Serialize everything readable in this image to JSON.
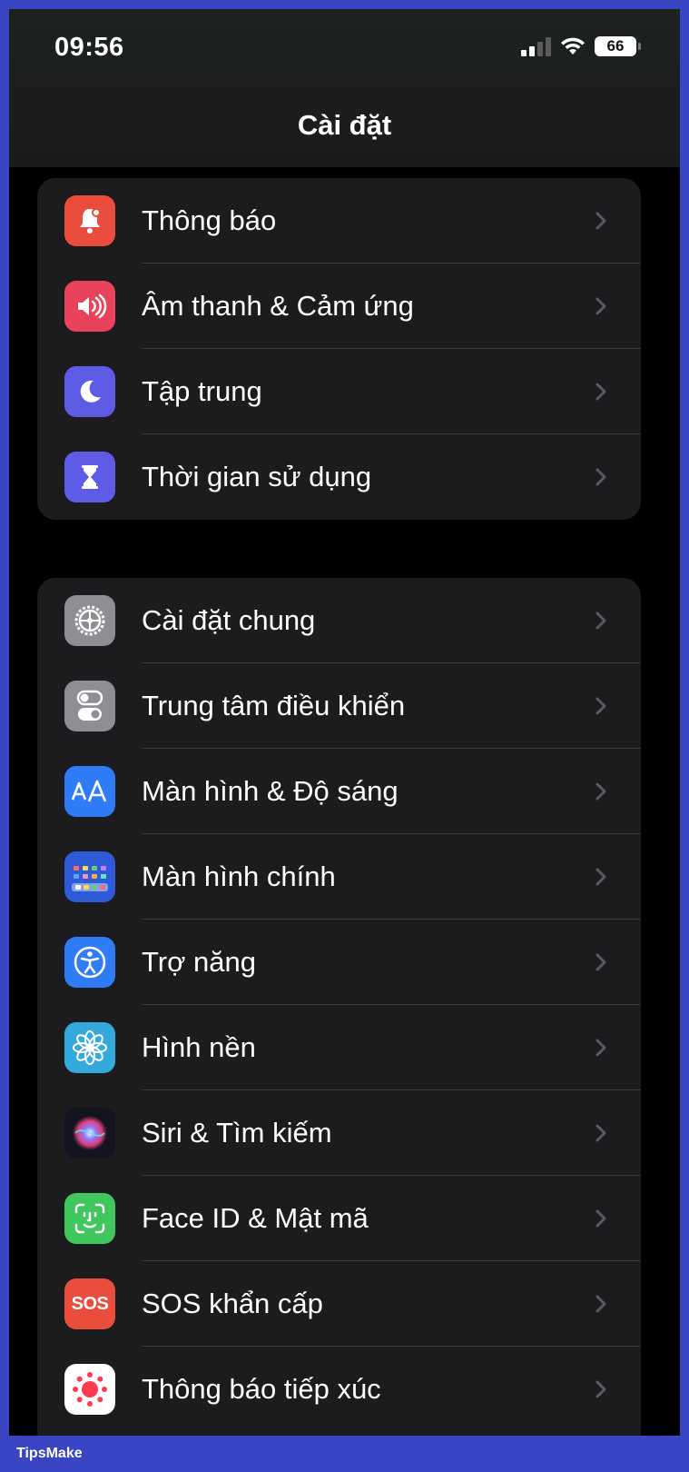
{
  "status_bar": {
    "time": "09:56",
    "battery": "66"
  },
  "nav": {
    "title": "Cài đặt"
  },
  "group1": [
    {
      "label": "Thông báo",
      "icon": "notifications-icon",
      "color": "#eb4d3d"
    },
    {
      "label": "Âm thanh & Cảm ứng",
      "icon": "sound-icon",
      "color": "#e8435a"
    },
    {
      "label": "Tập trung",
      "icon": "moon-icon",
      "color": "#5e5ce6"
    },
    {
      "label": "Thời gian sử dụng",
      "icon": "hourglass-icon",
      "color": "#5e5ce6"
    }
  ],
  "group2": [
    {
      "label": "Cài đặt chung",
      "icon": "gear-icon",
      "color": "#8e8e93"
    },
    {
      "label": "Trung tâm điều khiển",
      "icon": "toggles-icon",
      "color": "#8e8e93"
    },
    {
      "label": "Màn hình & Độ sáng",
      "icon": "text-size-icon",
      "color": "#2f7cf6"
    },
    {
      "label": "Màn hình chính",
      "icon": "home-grid-icon",
      "color": "#2f5bd9"
    },
    {
      "label": "Trợ năng",
      "icon": "accessibility-icon",
      "color": "#2f7cf6"
    },
    {
      "label": "Hình nền",
      "icon": "flower-icon",
      "color": "#34aadc"
    },
    {
      "label": "Siri & Tìm kiếm",
      "icon": "siri-icon",
      "color": "#1a1a2a"
    },
    {
      "label": "Face ID & Mật mã",
      "icon": "face-id-icon",
      "color": "#3fc75e"
    },
    {
      "label": "SOS khẩn cấp",
      "icon": "sos-icon",
      "color": "#eb4d3d",
      "icon_text": "SOS"
    },
    {
      "label": "Thông báo tiếp xúc",
      "icon": "exposure-icon",
      "color": "#ffffff"
    }
  ],
  "footer": {
    "brand": "TipsMake"
  }
}
